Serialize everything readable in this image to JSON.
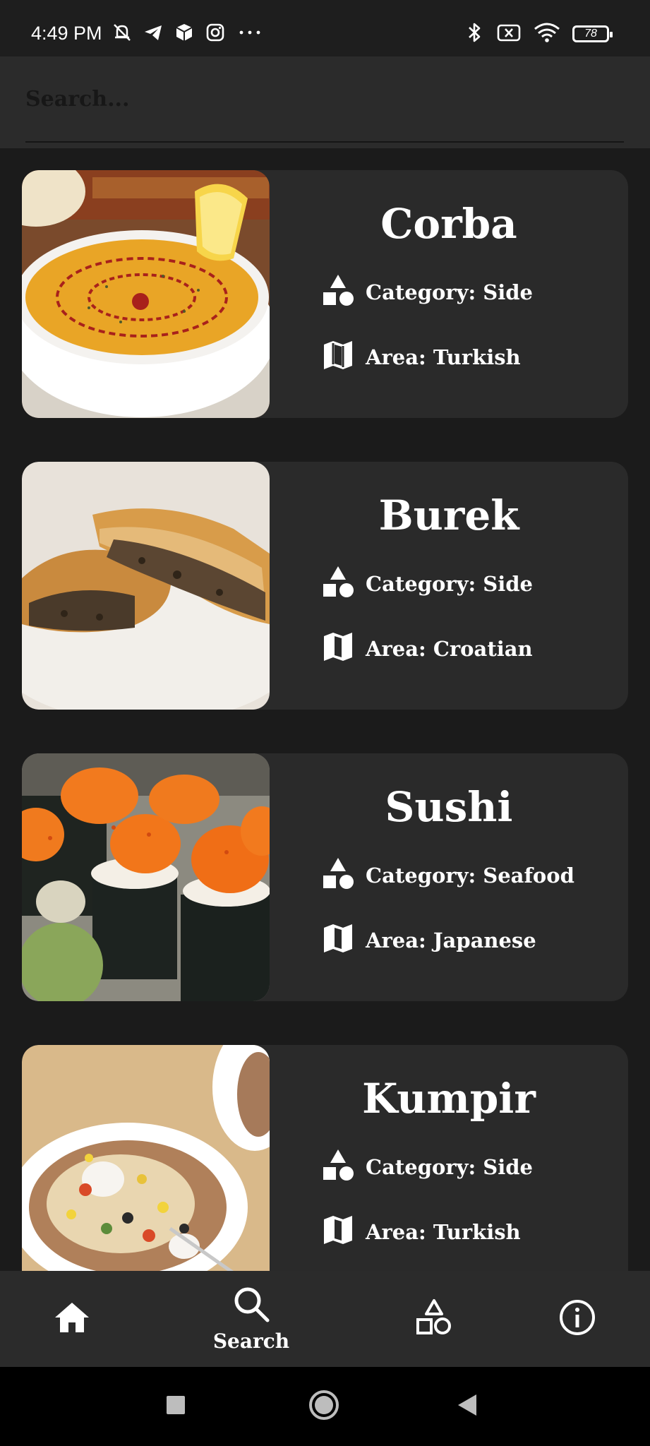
{
  "status_bar": {
    "time": "4:49 PM",
    "battery": "78",
    "left_icons": [
      "muted-bell-icon",
      "telegram-icon",
      "box-icon",
      "instagram-icon",
      "more-dots-icon"
    ],
    "right_icons": [
      "bluetooth-icon",
      "no-sim-icon",
      "wifi-icon",
      "battery-icon"
    ]
  },
  "search": {
    "placeholder": "Search..."
  },
  "labels": {
    "category_prefix": "Category: ",
    "area_prefix": "Area: "
  },
  "meals": [
    {
      "name": "Corba",
      "category": "Category: Side",
      "area": "Area: Turkish",
      "image": "lentil-soup-photo"
    },
    {
      "name": "Burek",
      "category": "Category: Side",
      "area": "Area: Croatian",
      "image": "burek-pastry-photo"
    },
    {
      "name": "Sushi",
      "category": "Category: Seafood",
      "area": "Area: Japanese",
      "image": "sushi-rolls-photo"
    },
    {
      "name": "Kumpir",
      "category": "Category: Side",
      "area": "Area: Turkish",
      "image": "stuffed-potato-photo"
    }
  ],
  "bottom_nav": {
    "items": [
      {
        "icon": "home-icon",
        "label": ""
      },
      {
        "icon": "search-icon",
        "label": "Search",
        "active": true
      },
      {
        "icon": "categories-shapes-icon",
        "label": ""
      },
      {
        "icon": "info-icon",
        "label": ""
      }
    ]
  },
  "system_nav": [
    "recents-square-icon",
    "home-circle-icon",
    "back-triangle-icon"
  ],
  "colors": {
    "background": "#1b1b1b",
    "card": "#2a2a2a",
    "search_bar": "#2b2b2b",
    "bottom_nav": "#2b2b2b",
    "text": "#ffffff"
  }
}
